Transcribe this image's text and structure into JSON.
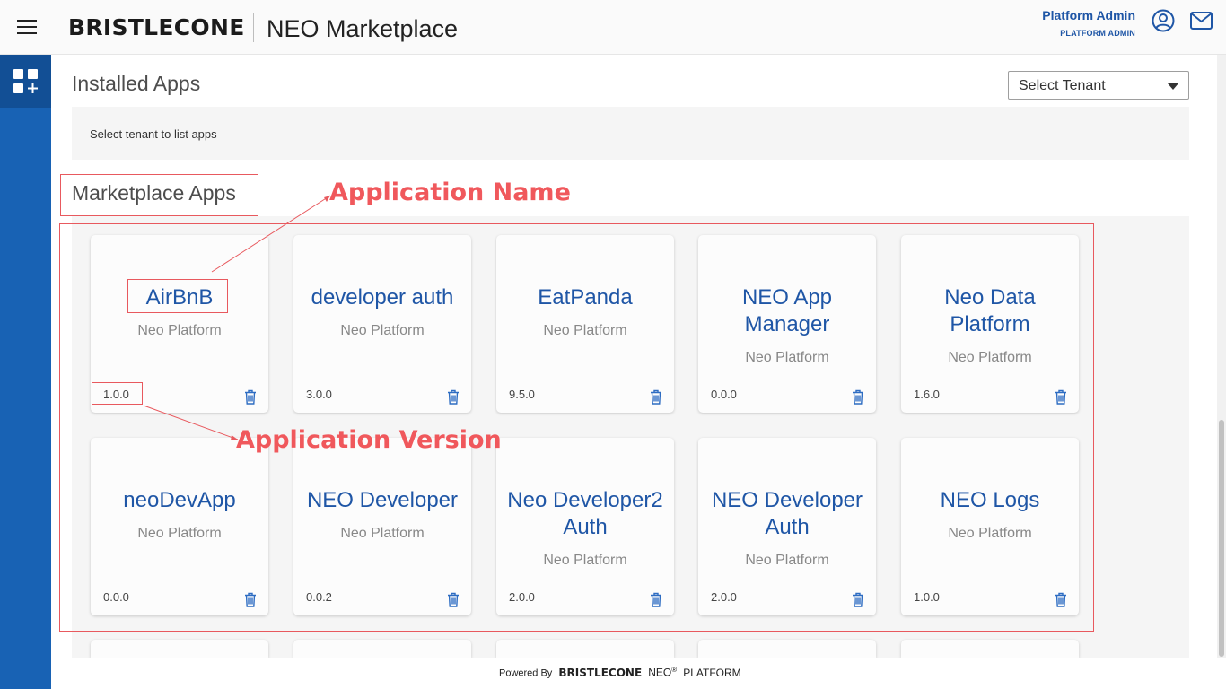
{
  "header": {
    "logo_text": "BRISTLECONE",
    "app_title": "NEO Marketplace",
    "user_name": "Platform Admin",
    "user_role": "PLATFORM ADMIN",
    "icons": [
      "menu-icon",
      "user-circle-icon",
      "mail-icon"
    ]
  },
  "sidebar": {
    "items": [
      {
        "icon": "apps-add-icon"
      }
    ]
  },
  "installed": {
    "title": "Installed Apps",
    "select_placeholder": "Select Tenant",
    "message": "Select tenant to list apps"
  },
  "marketplace": {
    "title": "Marketplace Apps",
    "apps": [
      {
        "name": "AirBnB",
        "vendor": "Neo Platform",
        "version": "1.0.0"
      },
      {
        "name": "developer auth",
        "vendor": "Neo Platform",
        "version": "3.0.0"
      },
      {
        "name": "EatPanda",
        "vendor": "Neo Platform",
        "version": "9.5.0"
      },
      {
        "name": "NEO App Manager",
        "vendor": "Neo Platform",
        "version": "0.0.0"
      },
      {
        "name": "Neo Data Platform",
        "vendor": "Neo Platform",
        "version": "1.6.0"
      },
      {
        "name": "neoDevApp",
        "vendor": "Neo Platform",
        "version": "0.0.0"
      },
      {
        "name": "NEO Developer",
        "vendor": "Neo Platform",
        "version": "0.0.2"
      },
      {
        "name": "Neo Developer2 Auth",
        "vendor": "Neo Platform",
        "version": "2.0.0"
      },
      {
        "name": "NEO Developer Auth",
        "vendor": "Neo Platform",
        "version": "2.0.0"
      },
      {
        "name": "NEO Logs",
        "vendor": "Neo Platform",
        "version": "1.0.0"
      }
    ]
  },
  "annotations": {
    "name_label": "Application Name",
    "version_label": "Application Version",
    "color": "#f0585c"
  },
  "footer": {
    "powered_by": "Powered By",
    "brand": "BRISTLECONE",
    "neo": "NEO",
    "registered": "®",
    "platform": "PLATFORM"
  },
  "colors": {
    "accent": "#1f56a6",
    "sidebar": "#1862b4",
    "sidebar_active": "#124f95"
  }
}
